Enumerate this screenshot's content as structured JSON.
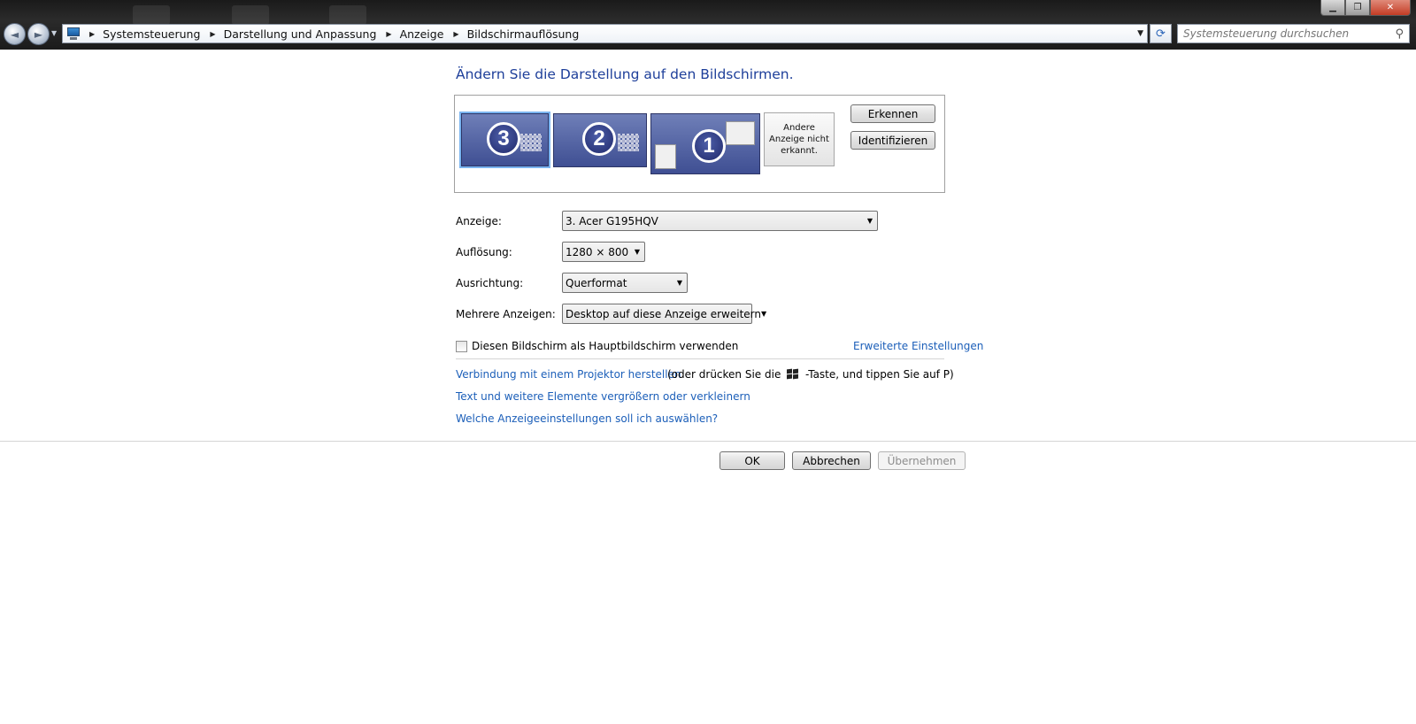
{
  "window": {
    "controls": {
      "minimize": "▁",
      "maximize": "❐",
      "close": "✕"
    }
  },
  "nav": {
    "back_icon": "◄",
    "forward_icon": "►",
    "history_icon": "▼"
  },
  "address": {
    "breadcrumbs": [
      "Systemsteuerung",
      "Darstellung und Anpassung",
      "Anzeige",
      "Bildschirmauflösung"
    ],
    "separator": "▶",
    "dropdown_icon": "▼",
    "refresh_icon": "⟳"
  },
  "search": {
    "placeholder": "Systemsteuerung durchsuchen",
    "icon": "⚲"
  },
  "main": {
    "heading": "Ändern Sie die Darstellung auf den Bildschirmen.",
    "monitors": [
      {
        "number": "3",
        "selected": true
      },
      {
        "number": "2",
        "selected": false
      },
      {
        "number": "1",
        "selected": false
      }
    ],
    "unrecognized_text": "Andere Anzeige nicht erkannt.",
    "detect_button": "Erkennen",
    "identify_button": "Identifizieren",
    "display_label": "Anzeige:",
    "display_value": "3. Acer G195HQV",
    "resolution_label": "Auflösung:",
    "resolution_value": "1280 × 800",
    "orientation_label": "Ausrichtung:",
    "orientation_value": "Querformat",
    "multiple_label": "Mehrere Anzeigen:",
    "multiple_value": "Desktop auf diese Anzeige erweitern",
    "caret": "▼",
    "primary_checkbox_label": "Diesen Bildschirm als Hauptbildschirm verwenden",
    "primary_checked": false,
    "advanced_link": "Erweiterte Einstellungen",
    "projector_link": "Verbindung mit einem Projektor herstellen",
    "projector_hint_pre": "(oder drücken Sie die",
    "projector_hint_post": "-Taste, und tippen Sie auf P)",
    "text_size_link": "Text und weitere Elemente vergrößern oder verkleinern",
    "help_link": "Welche Anzeigeeinstellungen soll ich auswählen?"
  },
  "footer": {
    "ok": "OK",
    "cancel": "Abbrechen",
    "apply": "Übernehmen"
  },
  "colors": {
    "heading": "#1e3f9a",
    "link": "#1c5fb9",
    "monitor": "#4f5fa0"
  }
}
